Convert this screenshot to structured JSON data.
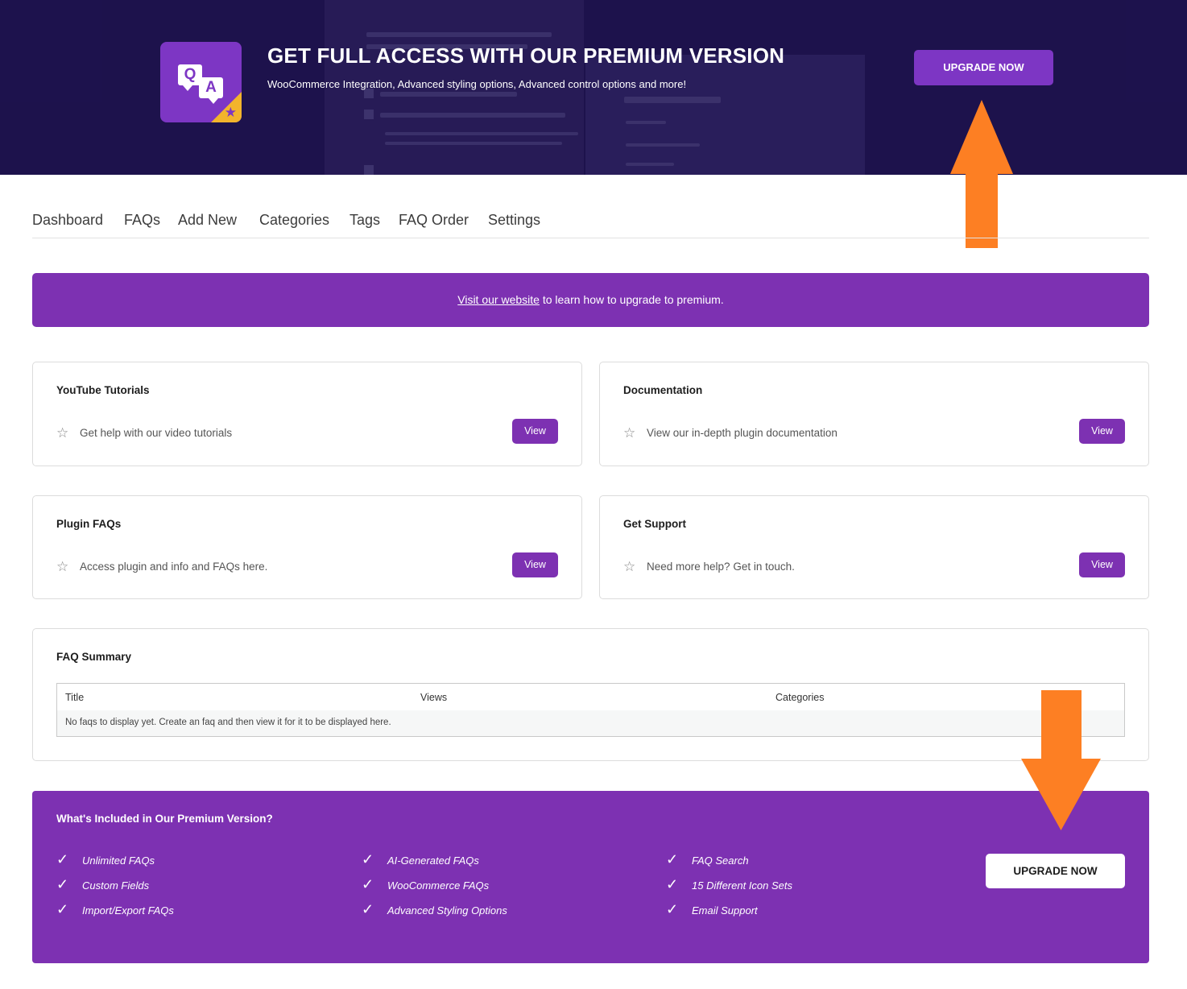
{
  "banner": {
    "title": "GET FULL ACCESS WITH OUR PREMIUM VERSION",
    "subtitle": "WooCommerce Integration, Advanced styling options, Advanced control options and more!",
    "button": "UPGRADE NOW",
    "logo_q": "Q",
    "logo_a": "A",
    "logo_star": "★"
  },
  "nav": {
    "items": [
      "Dashboard",
      "FAQs",
      "Add New",
      "Categories",
      "Tags",
      "FAQ Order",
      "Settings"
    ]
  },
  "notice": {
    "link": "Visit our website",
    "text": " to learn how to upgrade to premium."
  },
  "cards": [
    {
      "title": "YouTube Tutorials",
      "text": "Get help with our video tutorials",
      "button": "View",
      "icon": "star-outline-icon"
    },
    {
      "title": "Documentation",
      "text": "View our in-depth plugin documentation",
      "button": "View",
      "icon": "star-outline-icon"
    },
    {
      "title": "Plugin FAQs",
      "text": "Access plugin and info and FAQs here.",
      "button": "View",
      "icon": "star-outline-icon"
    },
    {
      "title": "Get Support",
      "text": "Need more help? Get in touch.",
      "button": "View",
      "icon": "star-outline-icon"
    }
  ],
  "star_glyph": "☆",
  "summary": {
    "title": "FAQ Summary",
    "columns": [
      "Title",
      "Views",
      "Categories"
    ],
    "empty": "No faqs to display yet. Create an faq and then view it for it to be displayed here."
  },
  "premium": {
    "title": "What's Included in Our Premium Version?",
    "check": "✓",
    "features": [
      "Unlimited FAQs",
      "Custom Fields",
      "Import/Export FAQs",
      "AI-Generated FAQs",
      "WooCommerce FAQs",
      "Advanced Styling Options",
      "FAQ Search",
      "15 Different Icon Sets",
      "Email Support"
    ],
    "button": "UPGRADE NOW"
  },
  "colors": {
    "banner_bg": "#1f1450",
    "accent": "#7d31b2",
    "arrow": "#fd7f23",
    "logo_badge": "#f2b42c"
  }
}
